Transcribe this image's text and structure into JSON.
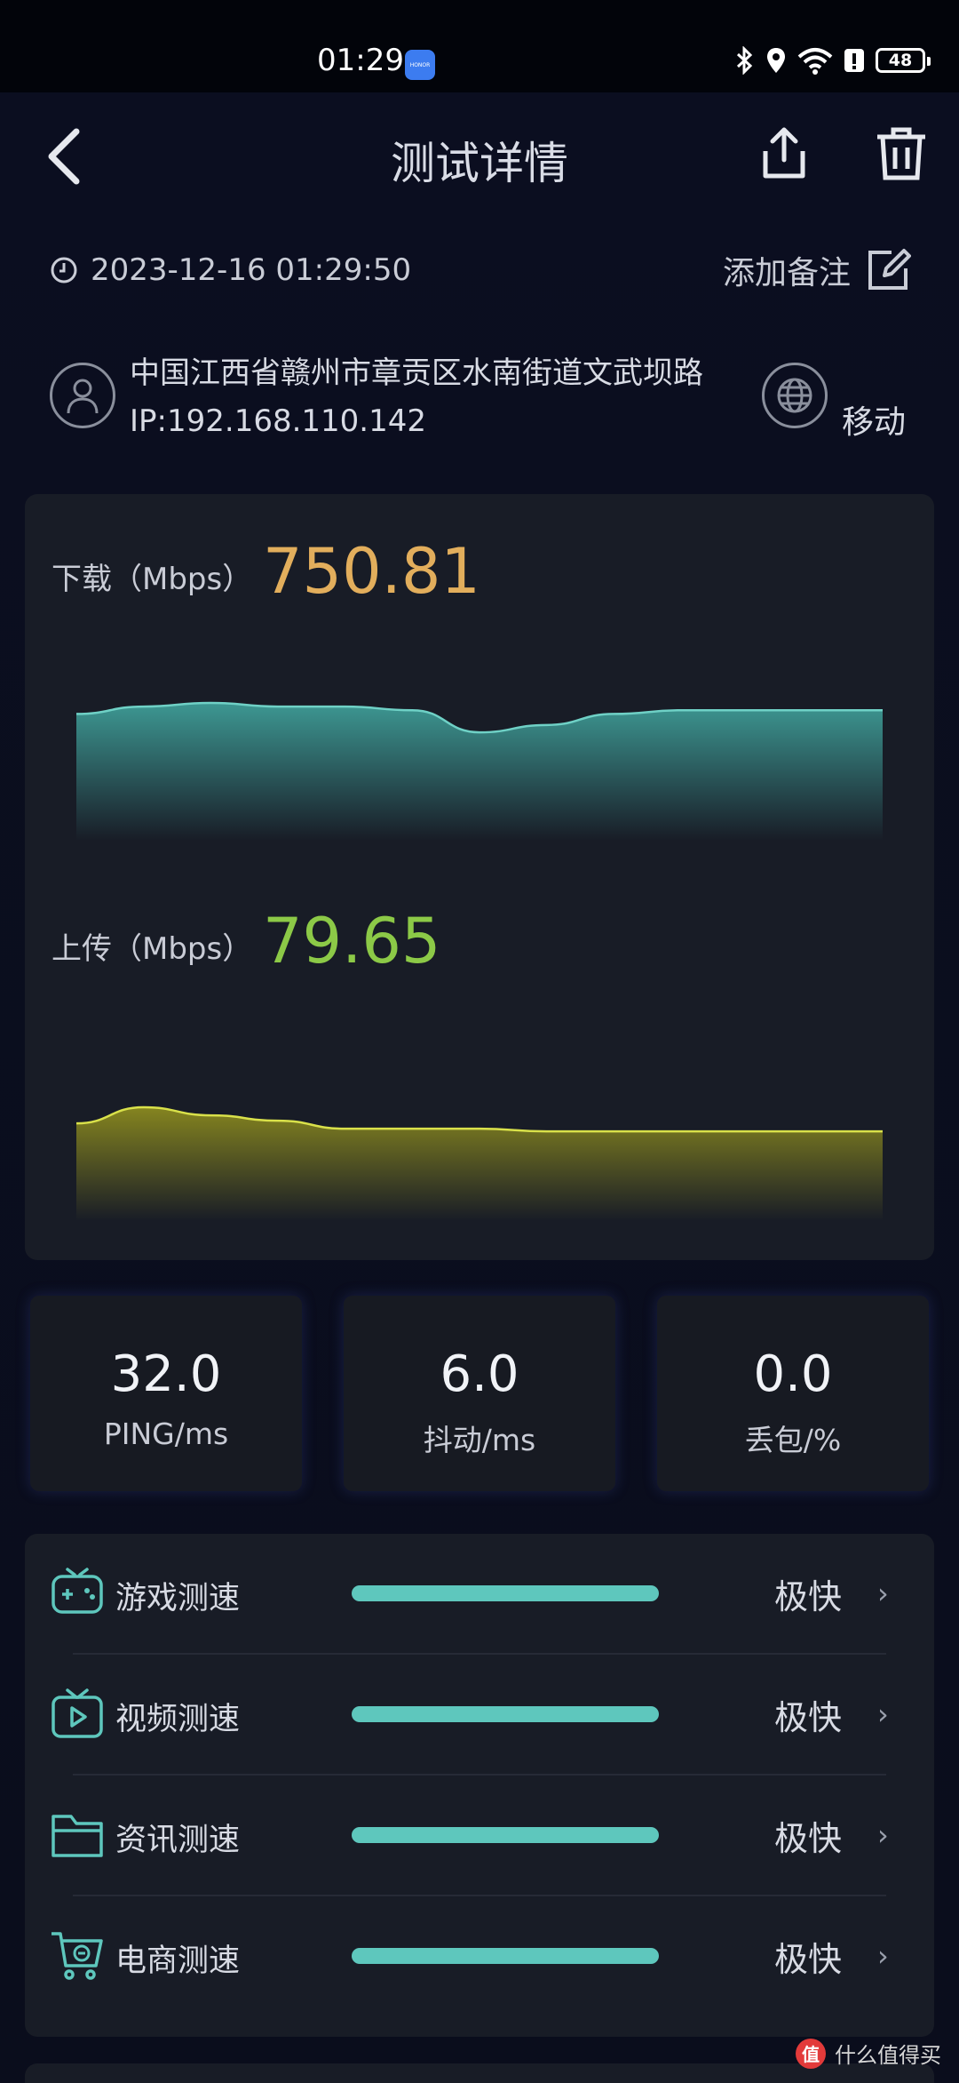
{
  "status_bar": {
    "time": "01:29",
    "brand": "HONOR",
    "battery": "48"
  },
  "header": {
    "title": "测试详情"
  },
  "meta": {
    "datetime": "2023-12-16 01:29:50",
    "note_label": "添加备注",
    "address": "中国江西省赣州市章贡区水南街道文武坝路",
    "ip": "IP:192.168.110.142",
    "carrier": "移动"
  },
  "download": {
    "label": "下载（Mbps）",
    "value": "750.81",
    "color": "#e2ae5c"
  },
  "upload": {
    "label": "上传（Mbps）",
    "value": "79.65",
    "color": "#8cc947"
  },
  "chart_data": [
    {
      "type": "area",
      "name": "下载（Mbps）",
      "values": [
        750,
        752,
        753,
        752,
        752,
        751,
        745,
        747,
        750,
        751,
        751,
        751,
        751
      ]
    },
    {
      "type": "area",
      "name": "上传（Mbps）",
      "values": [
        82,
        88,
        85,
        83,
        80,
        80,
        80,
        79,
        79,
        79,
        79,
        79,
        79
      ]
    }
  ],
  "stats": [
    {
      "value": "32.0",
      "label": "PING/ms"
    },
    {
      "value": "6.0",
      "label": "抖动/ms"
    },
    {
      "value": "0.0",
      "label": "丢包/%"
    }
  ],
  "speed_tests": [
    {
      "icon": "gamepad-icon",
      "label": "游戏测速",
      "result": "极快",
      "level": 1.0
    },
    {
      "icon": "video-tv-icon",
      "label": "视频测速",
      "result": "极快",
      "level": 1.0
    },
    {
      "icon": "folder-icon",
      "label": "资讯测速",
      "result": "极快",
      "level": 1.0
    },
    {
      "icon": "shopping-cart-icon",
      "label": "电商测速",
      "result": "极快",
      "level": 1.0
    }
  ],
  "watermark": {
    "logo": "值",
    "text": "什么值得买"
  },
  "colors": {
    "accent_teal": "#5ec7bd",
    "upload_line": "#d9e14a",
    "download_line": "#6fd1c6"
  }
}
